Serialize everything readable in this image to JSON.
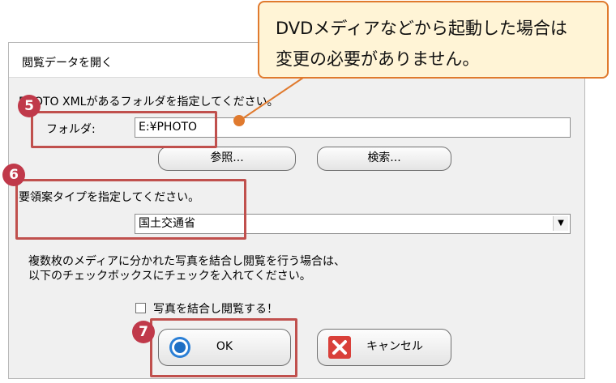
{
  "dialog": {
    "title": "閲覧データを開く",
    "folder_prompt": "PHOTO XMLがあるフォルダを指定してください。",
    "folder_label": "フォルダ:",
    "folder_value": "E:¥PHOTO",
    "browse_label": "参照...",
    "search_label": "検索...",
    "type_prompt": "要領案タイプを指定してください。",
    "type_value": "国土交通省",
    "merge_note_line1": "複数枚のメディアに分かれた写真を結合し閲覧を行う場合は、",
    "merge_note_line2": "以下のチェックボックスにチェックを入れてください。",
    "merge_checkbox_label": "写真を結合し閲覧する！",
    "merge_checked": false,
    "ok_label": "OK",
    "cancel_label": "キャンセル"
  },
  "callout": {
    "line1": "DVDメディアなどから起動した場合は",
    "line2": "変更の必要がありません。"
  },
  "steps": [
    "5",
    "6",
    "7"
  ],
  "colors": {
    "highlight": "#c0504d",
    "step": "#c0394a",
    "callout_border": "#e07a2e",
    "callout_fill": "#fff4d6"
  }
}
